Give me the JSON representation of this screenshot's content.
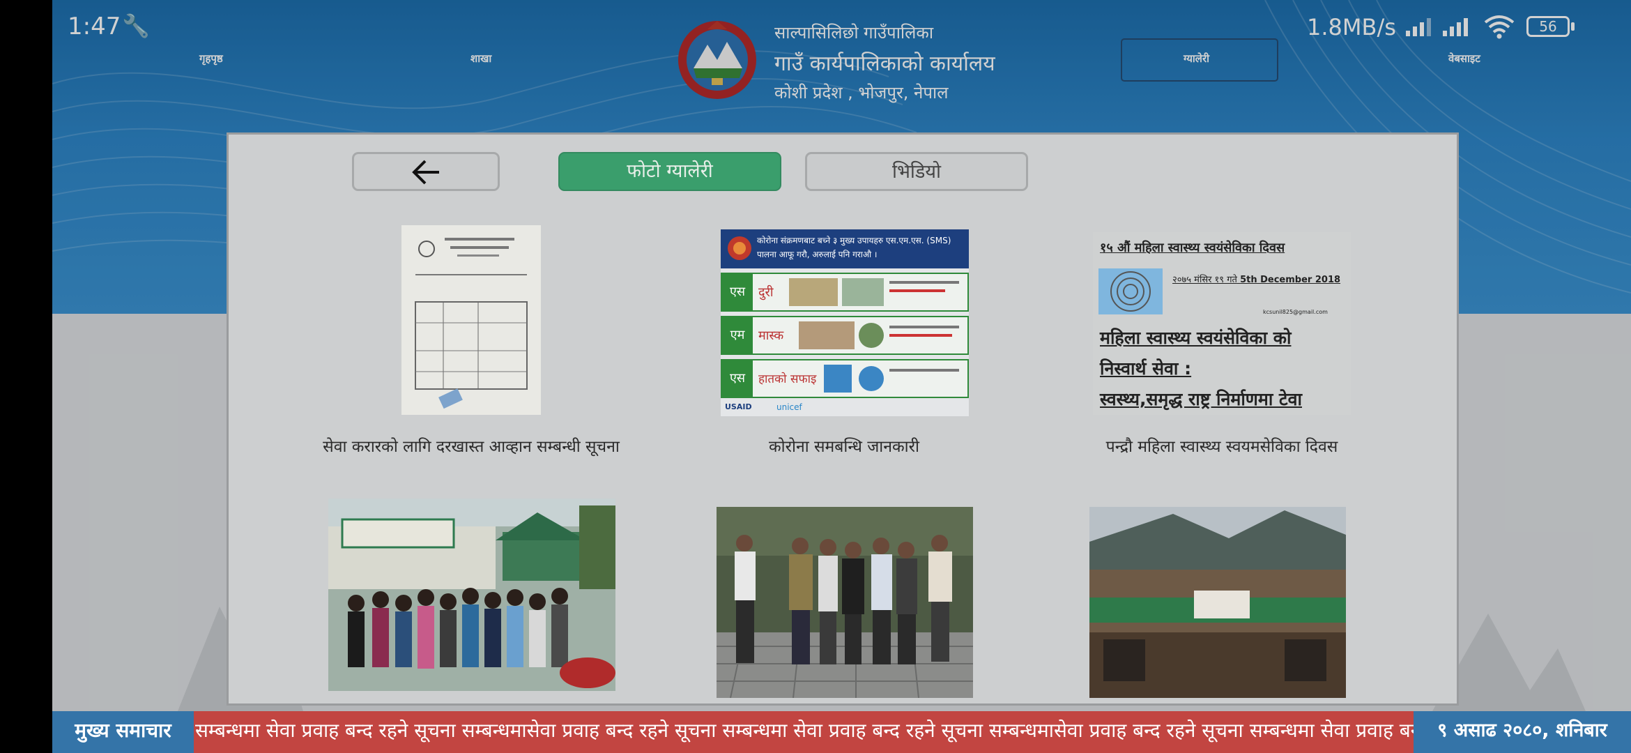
{
  "status_bar": {
    "time": "1:47",
    "net_rate": "1.8MB/s",
    "battery": "56"
  },
  "nav": {
    "home": "गृहपृष्ठ",
    "branch": "शाखा",
    "gallery": "ग्यालेरी",
    "website": "वेबसाइट"
  },
  "header": {
    "municipality": "साल्पासिलिछो गाउँपालिका",
    "office": "गाउँ कार्यपालिकाको कार्यालय",
    "address": "कोशी प्रदेश , भोजपुर, नेपाल"
  },
  "gallery": {
    "photo_tab": "फोटो ग्यालेरी",
    "video_tab": "भिडियो",
    "items": [
      {
        "caption": "सेवा करारको लागि दरखास्त आव्हान सम्बन्धी सूचना",
        "icon": "document-photo"
      },
      {
        "caption": "कोरोना समबन्धि जानकारी",
        "icon": "covid-poster",
        "poster": {
          "top": "कोरोना संक्रमणबाट बच्ने ३ मुख्य उपायहरु एस.एम.एस. (SMS)",
          "top2": "पालना आफू गरौ, अरुलाई पनि गराऔ ।",
          "rows": [
            {
              "tag": "एस",
              "label": "दुरी"
            },
            {
              "tag": "एम",
              "label": "मास्क"
            },
            {
              "tag": "एस",
              "label": "हातको सफाइ"
            }
          ],
          "logos": [
            "USAID",
            "unicef"
          ]
        }
      },
      {
        "caption": "पन्द्रौ महिला स्वास्थ्य स्वयमसेविका दिवस",
        "icon": "text-poster",
        "poster": {
          "title": "१५ औं महिला स्वास्थ्य स्वयंसेविका दिवस",
          "date_np": "२०७५ मंसिर १९ गते",
          "date_en": "5th December 2018",
          "email": "kcsunil825@gmail.com",
          "line1": "महिला स्वास्थ्य स्वयंसेविका को",
          "line2": "निस्वार्थ सेवा :",
          "line3": "स्वस्थ्य,समृद्ध राष्ट्र निर्माणमा टेवा"
        }
      },
      {
        "caption": "",
        "icon": "group-photo"
      },
      {
        "caption": "",
        "icon": "men-photo"
      },
      {
        "caption": "",
        "icon": "building-photo"
      }
    ]
  },
  "ticker": {
    "label": "मुख्य समाचार",
    "text": "सम्बन्धमा सेवा प्रवाह बन्द रहने सूचना सम्बन्धमासेवा प्रवाह बन्द रहने सूचना सम्बन्धमा सेवा प्रवाह बन्द रहने सूचना सम्बन्धमासेवा प्रवाह बन्द रहने सूचना सम्बन्धमा सेवा प्रवाह बन्द",
    "date": "९ असाढ २०८०, शनिबार"
  }
}
